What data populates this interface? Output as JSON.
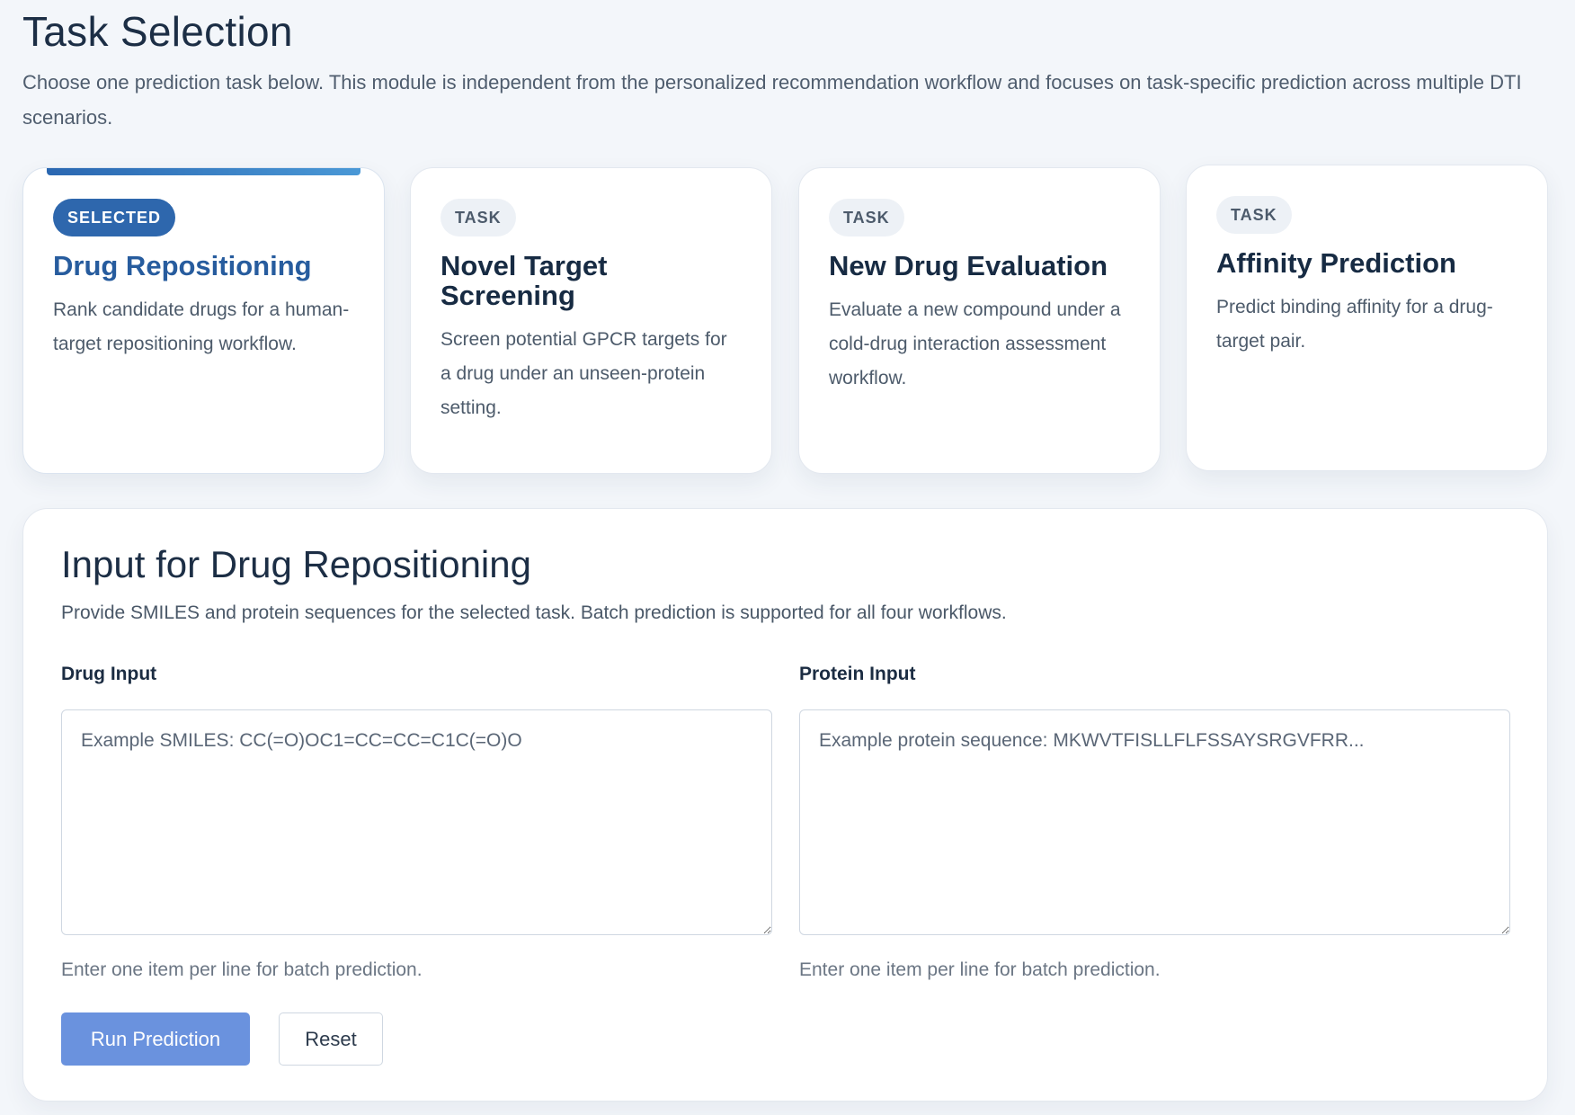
{
  "header": {
    "title": "Task Selection",
    "description": "Choose one prediction task below. This module is independent from the personalized recommendation workflow and focuses on task-specific prediction across multiple DTI scenarios."
  },
  "tasks": [
    {
      "badge": "SELECTED",
      "title": "Drug Repositioning",
      "description": "Rank candidate drugs for a human-target repositioning workflow.",
      "selected": true
    },
    {
      "badge": "TASK",
      "title": "Novel Target Screening",
      "description": "Screen potential GPCR targets for a drug under an unseen-protein setting.",
      "selected": false
    },
    {
      "badge": "TASK",
      "title": "New Drug Evaluation",
      "description": "Evaluate a new compound under a cold-drug interaction assessment workflow.",
      "selected": false
    },
    {
      "badge": "TASK",
      "title": "Affinity Prediction",
      "description": "Predict binding affinity for a drug-target pair.",
      "selected": false
    }
  ],
  "input_panel": {
    "title": "Input for Drug Repositioning",
    "description": "Provide SMILES and protein sequences for the selected task. Batch prediction is supported for all four workflows.",
    "drug": {
      "label": "Drug Input",
      "value": "",
      "placeholder": "Example SMILES: CC(=O)OC1=CC=CC=C1C(=O)O",
      "hint": "Enter one item per line for batch prediction."
    },
    "protein": {
      "label": "Protein Input",
      "value": "",
      "placeholder": "Example protein sequence: MKWVTFISLLFLFSSAYSRGVFRR...",
      "hint": "Enter one item per line for batch prediction."
    },
    "run_label": "Run Prediction",
    "reset_label": "Reset"
  },
  "colors": {
    "accent": "#2e67ad",
    "run_button": "#6a92de",
    "background": "#f3f6fa"
  }
}
